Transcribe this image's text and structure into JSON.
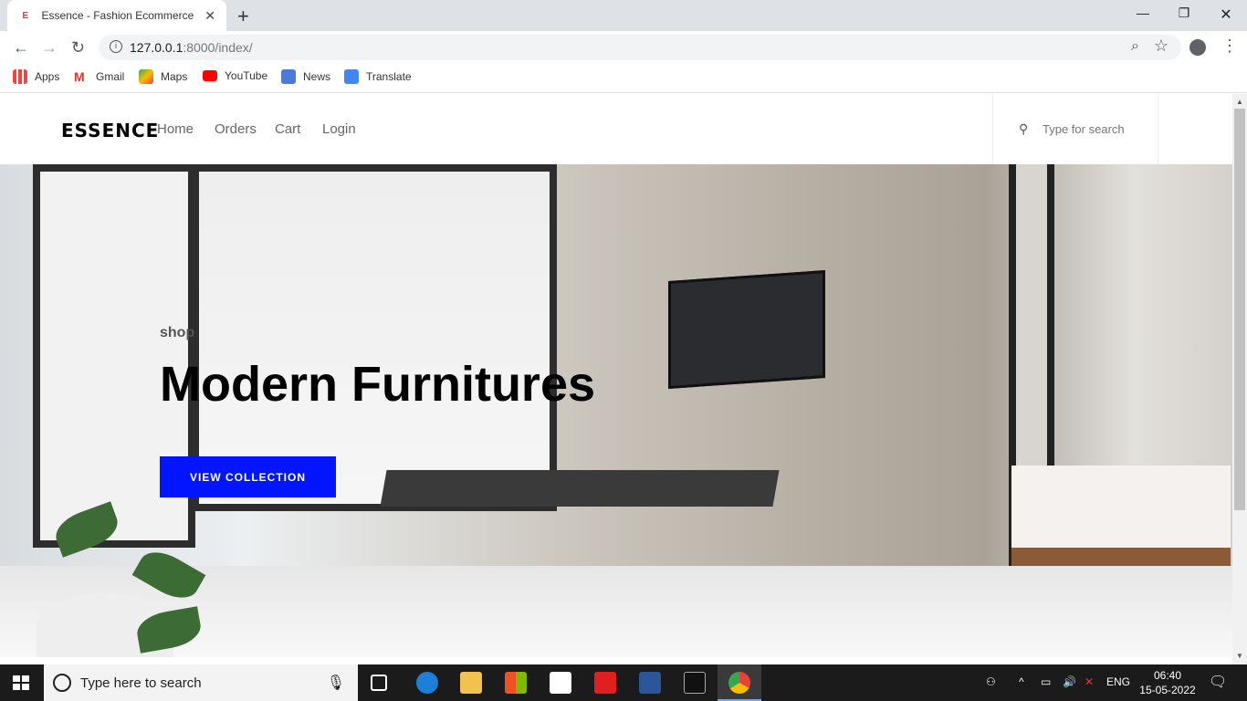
{
  "browser": {
    "tab_title": "Essence - Fashion Ecommerce Template",
    "favicon_letter": "E",
    "new_tab": "+",
    "close_tab": "✕",
    "minimize": "—",
    "restore": "❐",
    "close_window": "✕",
    "url_host": "127.0.0.1",
    "url_rest": ":8000/index/"
  },
  "bookmarks": [
    {
      "label": "Apps",
      "icon": "apps-grid-icon"
    },
    {
      "label": "Gmail",
      "icon": "gmail-icon"
    },
    {
      "label": "Maps",
      "icon": "maps-icon"
    },
    {
      "label": "YouTube",
      "icon": "youtube-icon"
    },
    {
      "label": "News",
      "icon": "news-icon"
    },
    {
      "label": "Translate",
      "icon": "translate-icon"
    }
  ],
  "site": {
    "logo": "ESSENCE",
    "nav": [
      "Home",
      "Orders",
      "Cart",
      "Login"
    ],
    "search_placeholder": "Type for search"
  },
  "hero": {
    "eyebrow": "shop",
    "title": "Modern Furnitures",
    "cta_label": "VIEW COLLECTION",
    "cta_color": "#0315ff"
  },
  "taskbar": {
    "search_placeholder": "Type here to search",
    "language": "ENG",
    "time": "06:40",
    "date": "15-05-2022"
  }
}
